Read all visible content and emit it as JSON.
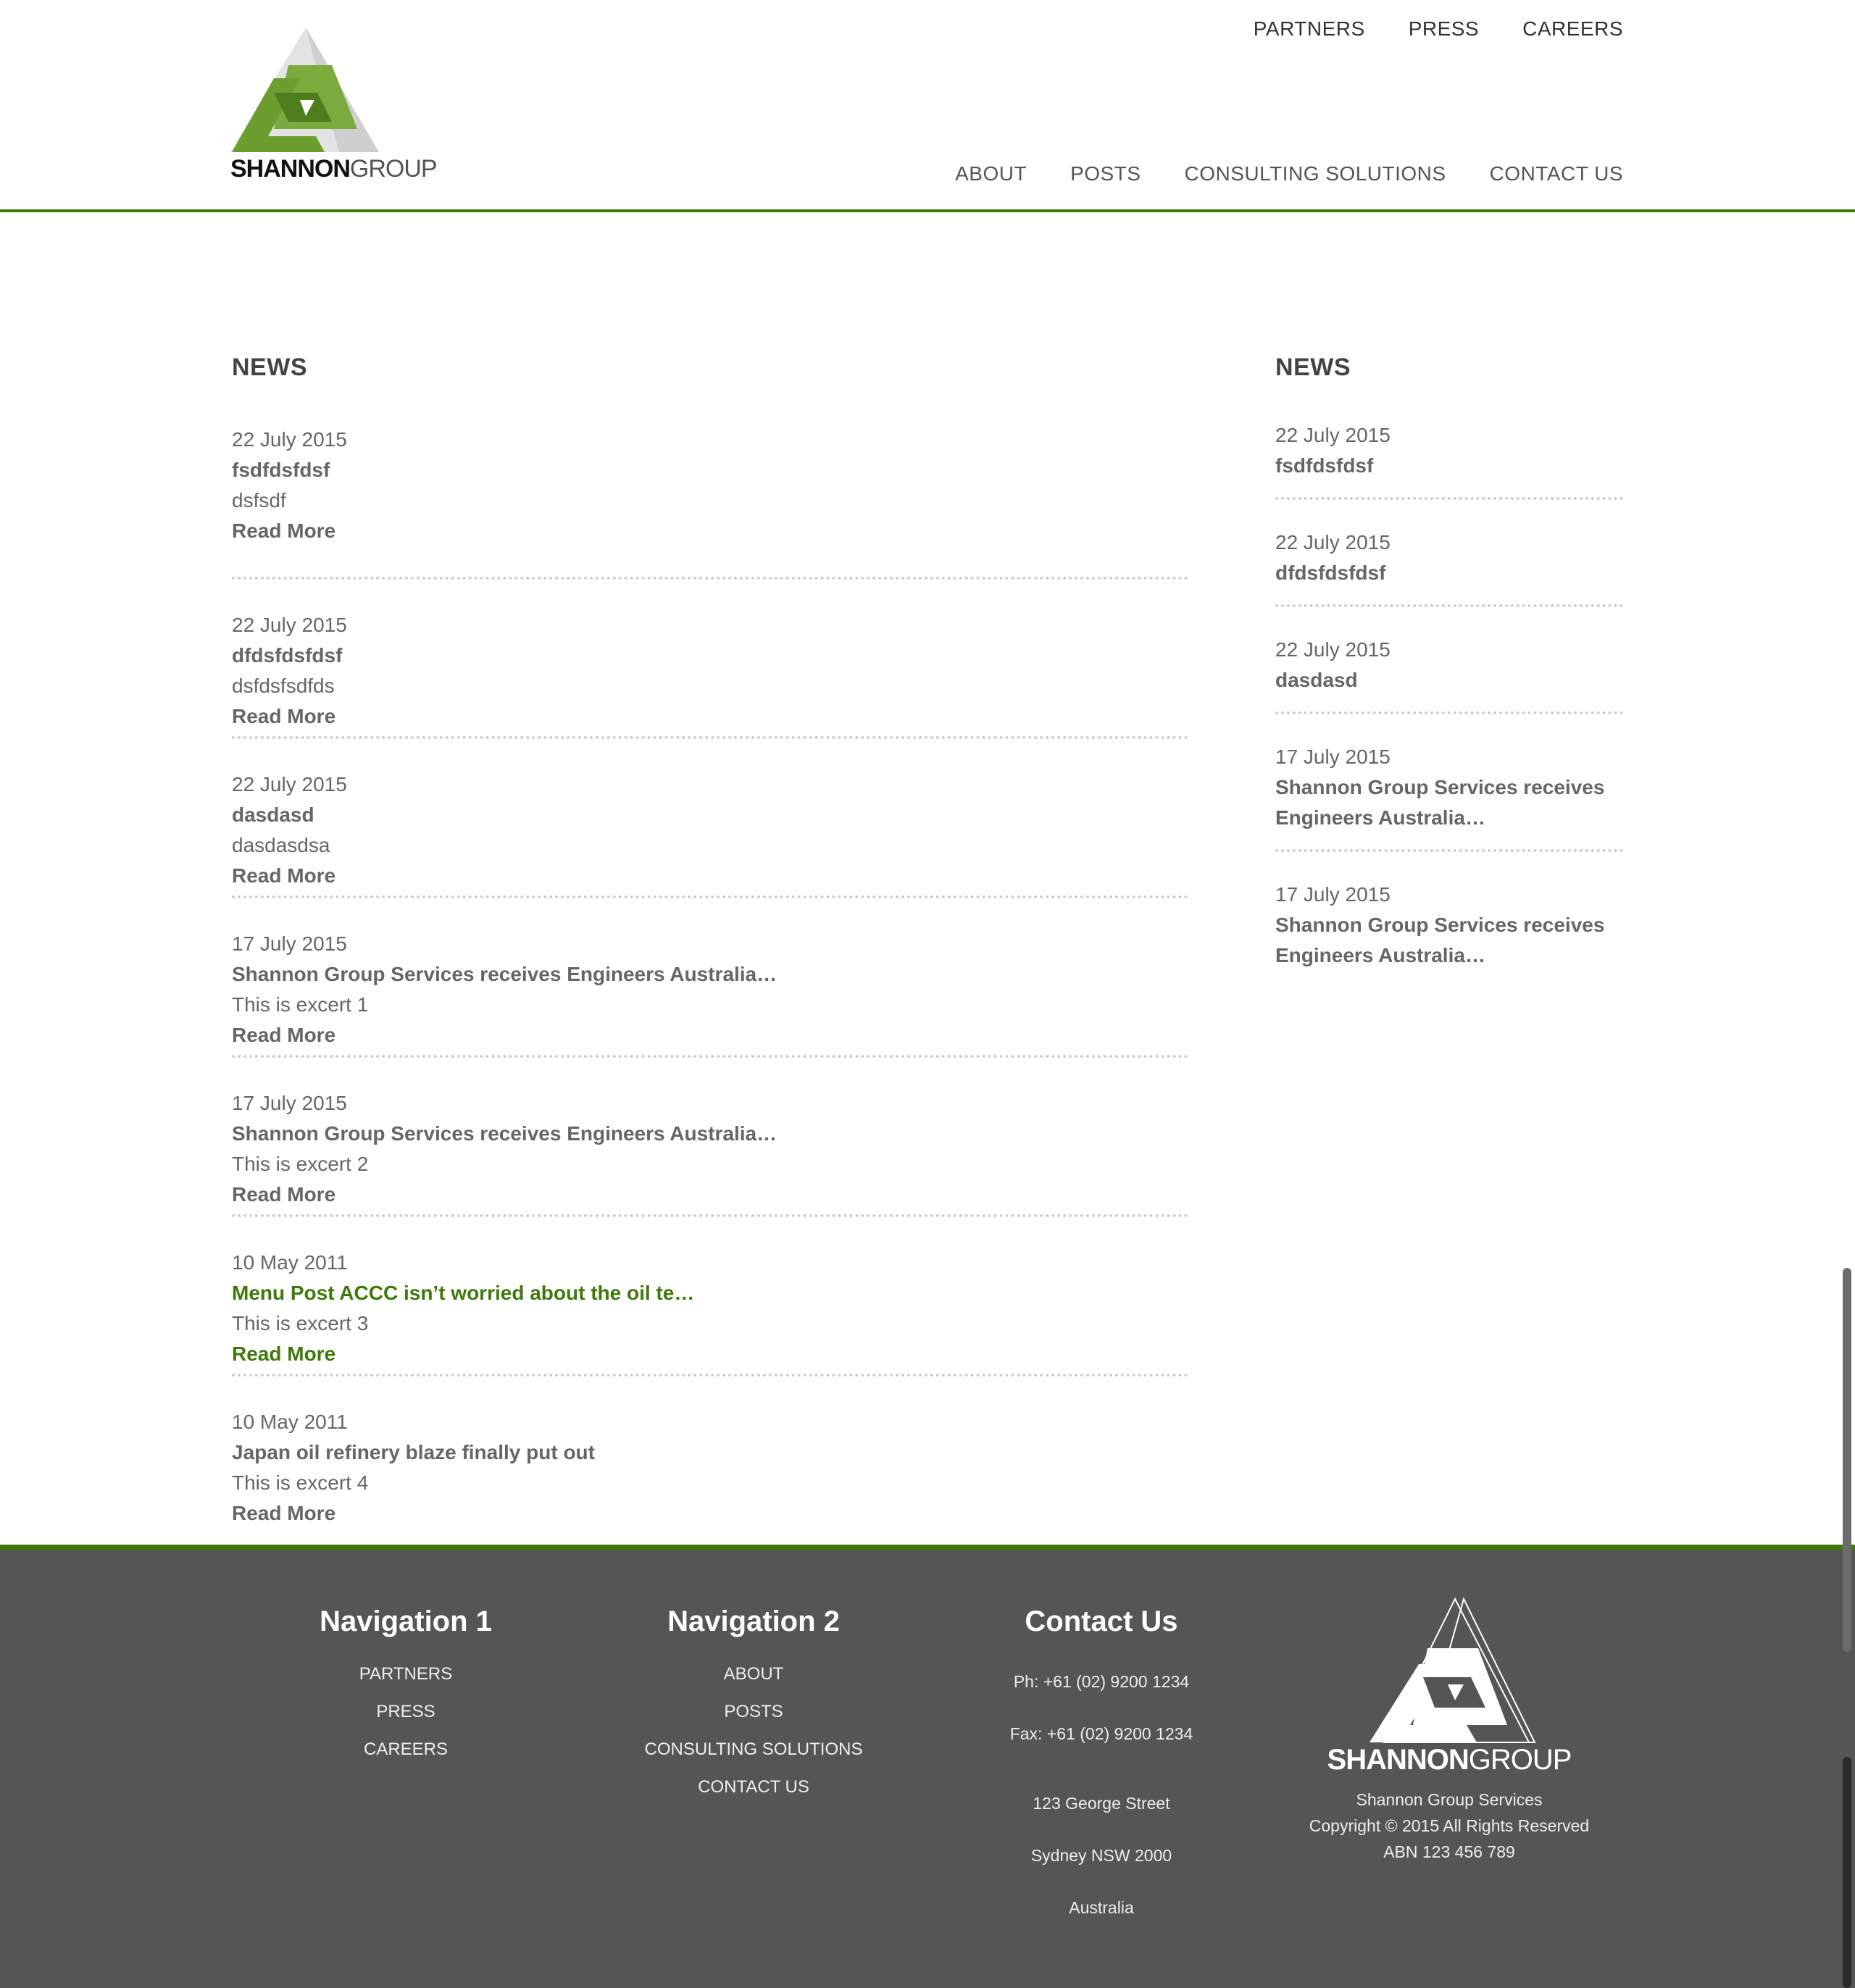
{
  "brand": {
    "logo_bold": "SHANNON",
    "logo_light": "GROUP",
    "accent_color": "#3e7a0a",
    "footer_bg": "#555555"
  },
  "top_nav": [
    "PARTNERS",
    "PRESS",
    "CAREERS"
  ],
  "main_nav": [
    "ABOUT",
    "POSTS",
    "CONSULTING SOLUTIONS",
    "CONTACT US"
  ],
  "news_main": {
    "title": "NEWS",
    "items": [
      {
        "date": "22 July 2015",
        "title": "fsdfdsfdsf",
        "excerpt": "dsfsdf",
        "read_more": "Read More"
      },
      {
        "date": "22 July 2015",
        "title": "dfdsfdsfdsf",
        "excerpt": "dsfdsfsdfds",
        "read_more": "Read More"
      },
      {
        "date": "22 July 2015",
        "title": "dasdasd",
        "excerpt": "dasdasdsa",
        "read_more": "Read More"
      },
      {
        "date": "17 July 2015",
        "title": "Shannon Group Services receives Engineers Australia…",
        "excerpt": "This is excert 1",
        "read_more": "Read More"
      },
      {
        "date": "17 July 2015",
        "title": "Shannon Group Services receives Engineers Australia…",
        "excerpt": "This is excert 2",
        "read_more": "Read More"
      },
      {
        "date": "10 May 2011",
        "title": "Menu Post ACCC isn’t worried about the oil te…",
        "excerpt": "This is excert 3",
        "read_more": "Read More"
      },
      {
        "date": "10 May 2011",
        "title": "Japan oil refinery blaze finally put out",
        "excerpt": "This is excert 4",
        "read_more": "Read More"
      }
    ]
  },
  "news_side": {
    "title": "NEWS",
    "items": [
      {
        "date": "22 July 2015",
        "title": "fsdfdsfdsf"
      },
      {
        "date": "22 July 2015",
        "title": "dfdsfdsfdsf"
      },
      {
        "date": "22 July 2015",
        "title": "dasdasd"
      },
      {
        "date": "17 July 2015",
        "title": "Shannon Group Services receives Engineers Australia…"
      },
      {
        "date": "17 July 2015",
        "title": "Shannon Group Services receives Engineers Australia…"
      }
    ]
  },
  "footer": {
    "nav1": {
      "title": "Navigation 1",
      "links": [
        "PARTNERS",
        "PRESS",
        "CAREERS"
      ]
    },
    "nav2": {
      "title": "Navigation 2",
      "links": [
        "ABOUT",
        "POSTS",
        "CONSULTING SOLUTIONS",
        "CONTACT US"
      ]
    },
    "contact": {
      "title": "Contact Us",
      "phone": "Ph: +61 (02) 9200 1234",
      "fax": "Fax: +61 (02) 9200 1234",
      "address1": "123 George Street",
      "address2": "Sydney NSW 2000",
      "address3": "Australia"
    },
    "company": {
      "name": "Shannon Group Services",
      "copyright": "Copyright © 2015 All Rights Reserved",
      "abn": "ABN 123 456 789"
    }
  }
}
